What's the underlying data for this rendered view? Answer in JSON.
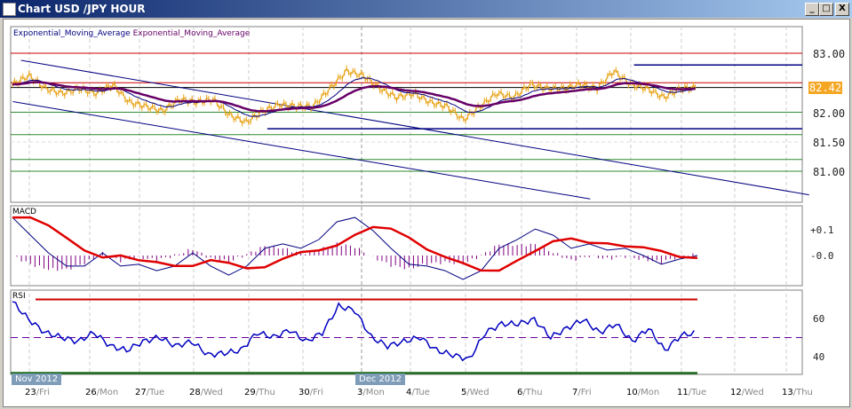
{
  "window": {
    "title": "Chart USD /JPY  HOUR",
    "min": "_",
    "max": "□",
    "close": "X"
  },
  "legend": {
    "ema1": "Exponential_Moving_Average",
    "ema2": "Exponential_Moving_Average",
    "macd": "MACD",
    "rsi": "RSI"
  },
  "colors": {
    "price": "#e8a317",
    "ema_fast": "#000080",
    "ema_slow": "#660066",
    "macd": "#000080",
    "signal": "#e00000",
    "hist": "#800080",
    "rsi": "#0000c0",
    "red": "#cc0000",
    "green": "#2e8b2e",
    "navy": "#000080"
  },
  "chart_data": {
    "type": "line",
    "price_axis": {
      "ticks": [
        "83.00",
        "82.00",
        "81.50",
        "81.00"
      ],
      "current": "82.42",
      "range": [
        80.5,
        83.5
      ]
    },
    "price": [
      82.47,
      82.62,
      82.4,
      82.32,
      82.4,
      82.32,
      82.47,
      82.17,
      82.1,
      82.02,
      82.22,
      82.17,
      82.22,
      81.95,
      81.83,
      82.02,
      82.13,
      82.1,
      82.1,
      82.4,
      82.7,
      82.62,
      82.4,
      82.25,
      82.32,
      82.17,
      82.1,
      81.87,
      82.1,
      82.32,
      82.25,
      82.47,
      82.4,
      82.4,
      82.47,
      82.4,
      82.7,
      82.47,
      82.4,
      82.25,
      82.4,
      82.42
    ],
    "levels": [
      {
        "v": 83.0,
        "c": "red"
      },
      {
        "v": 82.5,
        "c": "red"
      },
      {
        "v": 82.8,
        "c": "navy",
        "from": 11
      },
      {
        "v": 82.42,
        "c": "black"
      },
      {
        "v": 82.0,
        "c": "green"
      },
      {
        "v": 81.72,
        "c": "navy",
        "from": 4.3
      },
      {
        "v": 81.62,
        "c": "green"
      },
      {
        "v": 81.2,
        "c": "green"
      },
      {
        "v": 81.0,
        "c": "green"
      }
    ],
    "channel": [
      {
        "from": [
          -0.2,
          82.88
        ],
        "to": [
          14.2,
          80.6
        ]
      },
      {
        "from": [
          -0.35,
          82.18
        ],
        "to": [
          10.2,
          80.53
        ]
      }
    ],
    "macd_axis": {
      "ticks": [
        "+0.1",
        "-0.0"
      ]
    },
    "macd": [
      0.148,
      0.079,
      0.01,
      -0.041,
      -0.041,
      0.01,
      -0.041,
      -0.034,
      -0.059,
      -0.041,
      0.01,
      -0.041,
      -0.076,
      -0.041,
      0.028,
      0.045,
      0.028,
      0.062,
      0.131,
      0.148,
      0.097,
      0.028,
      -0.034,
      -0.041,
      -0.059,
      -0.093,
      -0.059,
      0.028,
      0.062,
      0.103,
      0.079,
      0.028,
      0.045,
      0.021,
      0.028,
      0,
      -0.034,
      -0.014,
      0
    ],
    "rsi_axis": {
      "ticks": [
        "60",
        "40"
      ],
      "upper": 70,
      "lower": 30
    },
    "rsi": [
      68.8,
      59.5,
      52.6,
      50.2,
      47.9,
      52.6,
      45.6,
      43.3,
      47.9,
      50.2,
      45.6,
      47.9,
      40.9,
      41.9,
      43.3,
      52.6,
      50.2,
      54,
      47.9,
      52.6,
      66.5,
      64.2,
      50.2,
      45.6,
      47.9,
      50.2,
      43.3,
      40.9,
      38.6,
      52.6,
      57.2,
      57.2,
      59.5,
      50.2,
      54.9,
      59.5,
      52.6,
      57.2,
      47.9,
      54.9,
      43.3,
      51.2,
      52.6
    ],
    "months": [
      "Nov 2012",
      "Dec 2012"
    ],
    "dates": [
      {
        "d": "23",
        "w": "/Fri"
      },
      {
        "d": "26",
        "w": "/Mon"
      },
      {
        "d": "27",
        "w": "/Tue"
      },
      {
        "d": "28",
        "w": "/Wed"
      },
      {
        "d": "29",
        "w": "/Thu"
      },
      {
        "d": "30",
        "w": "/Fri"
      },
      {
        "d": "3",
        "w": "/Mon"
      },
      {
        "d": "4",
        "w": "/Tue"
      },
      {
        "d": "5",
        "w": "/Wed"
      },
      {
        "d": "6",
        "w": "/Thu"
      },
      {
        "d": "7",
        "w": "/Fri"
      },
      {
        "d": "10",
        "w": "/Mon"
      },
      {
        "d": "11",
        "w": "/Tue"
      },
      {
        "d": "12",
        "w": "/Wed"
      },
      {
        "d": "13",
        "w": "/Thu"
      }
    ]
  }
}
